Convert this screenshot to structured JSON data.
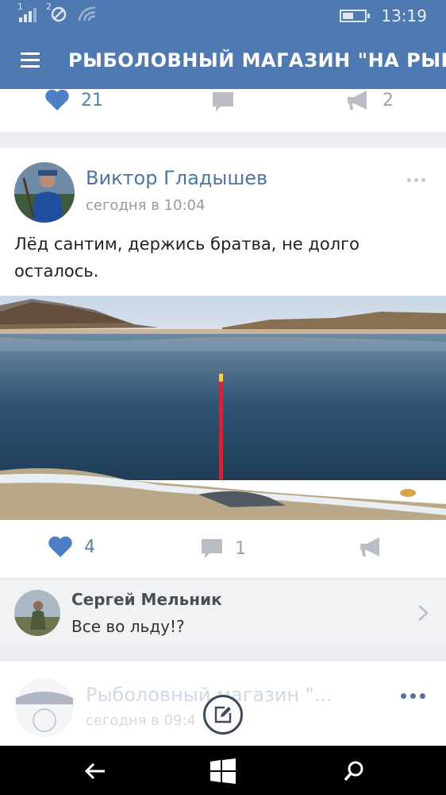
{
  "status": {
    "signal1": "1",
    "signal2": "2",
    "time": "13:19",
    "battery_level": 0.5
  },
  "header": {
    "title": "РЫБОЛОВНЫЙ МАГАЗИН  \"НА РЫБАЛКУ\""
  },
  "prev_post": {
    "likes": "21",
    "shares": "2"
  },
  "post": {
    "author": "Виктор Гладышев",
    "time": "сегодня в 10:04",
    "text": "Лёд сантим, держись братва, не долго осталось.",
    "likes": "4",
    "comments": "1"
  },
  "comment": {
    "author": "Сергей Мельник",
    "text": "Все во льду!?"
  },
  "next_post": {
    "author": "Рыболовный магазин  \"...",
    "time": "сегодня в 09:4"
  },
  "colors": {
    "accent": "#4f79b1",
    "like": "#4d7ec6",
    "icon_gray": "#b9bec4"
  }
}
